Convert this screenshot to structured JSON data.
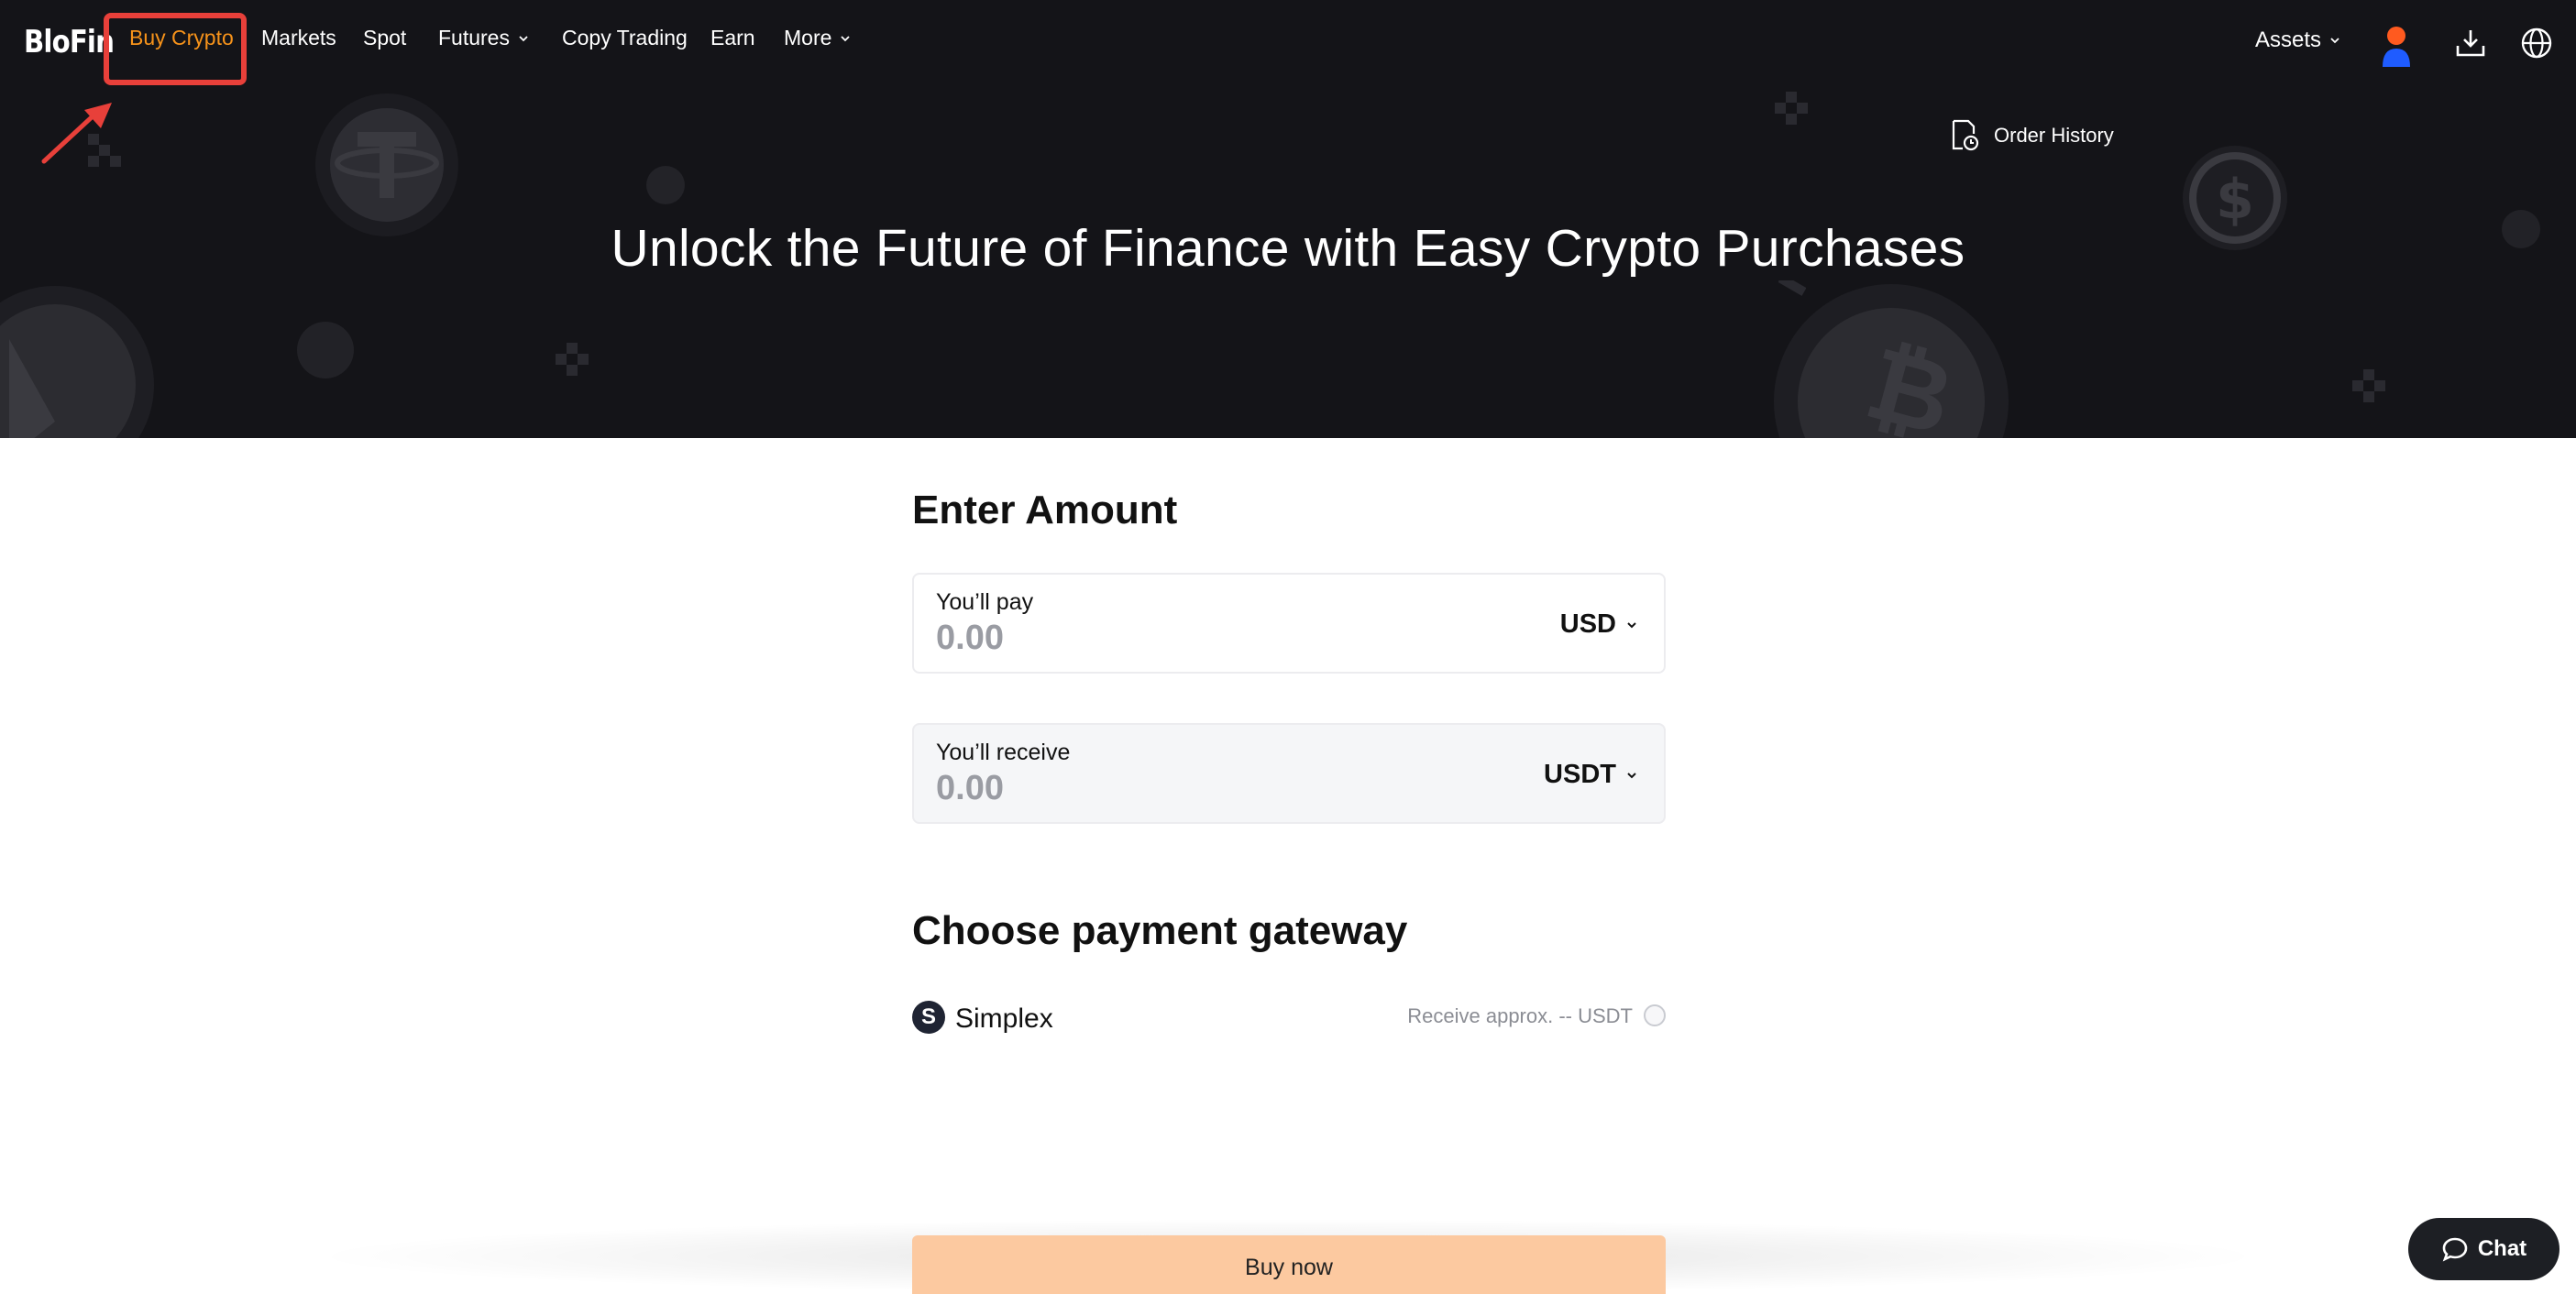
{
  "brand": {
    "logo_text": "BloFin",
    "accent_color": "#f7931a",
    "highlight_color": "#e8403a"
  },
  "nav": {
    "items": [
      {
        "label": "Buy Crypto",
        "active": true
      },
      {
        "label": "Markets"
      },
      {
        "label": "Spot"
      },
      {
        "label": "Futures",
        "has_dropdown": true
      },
      {
        "label": "Copy Trading"
      },
      {
        "label": "Earn"
      },
      {
        "label": "More",
        "has_dropdown": true
      }
    ],
    "assets_label": "Assets",
    "icons": [
      "user-avatar-icon",
      "download-icon",
      "globe-icon"
    ]
  },
  "hero": {
    "order_history_label": "Order History",
    "title": "Unlock the Future of Finance with Easy Crypto Purchases"
  },
  "amount": {
    "section_title": "Enter Amount",
    "pay": {
      "label": "You’ll pay",
      "value": "0.00",
      "currency": "USD"
    },
    "receive": {
      "label": "You’ll receive",
      "value": "0.00",
      "currency": "USDT"
    }
  },
  "gateway": {
    "section_title": "Choose payment gateway",
    "options": [
      {
        "logo_letter": "S",
        "name": "Simplex",
        "approx_text": "Receive approx. -- USDT",
        "selected": false
      }
    ]
  },
  "actions": {
    "buy_label": "Buy now",
    "buy_color": "#fcc9a0"
  },
  "chat": {
    "label": "Chat"
  }
}
